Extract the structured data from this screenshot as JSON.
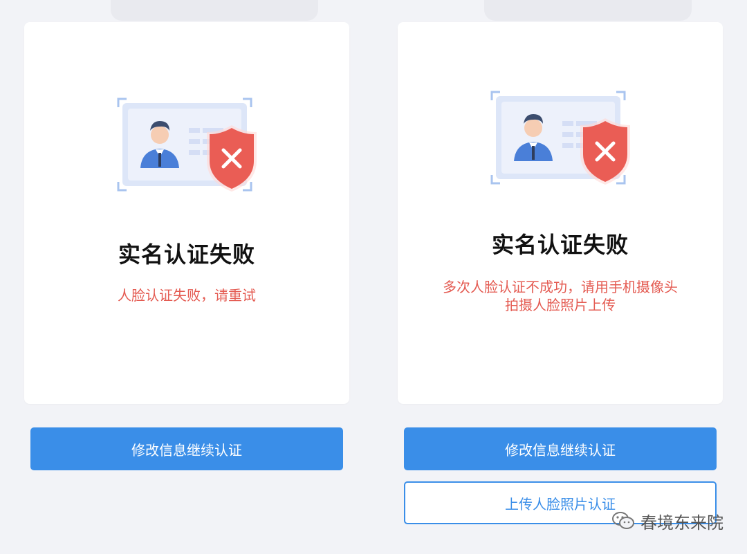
{
  "colors": {
    "page_bg": "#f2f3f7",
    "card_bg": "#ffffff",
    "primary": "#3a8ee8",
    "error": "#e45b52",
    "title": "#111111"
  },
  "left_panel": {
    "title": "实名认证失败",
    "message_lines": [
      "人脸认证失败，请重试"
    ],
    "primary_button": "修改信息继续认证",
    "icon": "id-card-failed-icon"
  },
  "right_panel": {
    "title": "实名认证失败",
    "message_lines": [
      "多次人脸认证不成功，请用手机摄像头",
      "拍摄人脸照片上传"
    ],
    "primary_button": "修改信息继续认证",
    "secondary_button": "上传人脸照片认证",
    "icon": "id-card-failed-icon"
  },
  "watermark": {
    "text": "春境东来院",
    "icon": "wechat-icon"
  }
}
